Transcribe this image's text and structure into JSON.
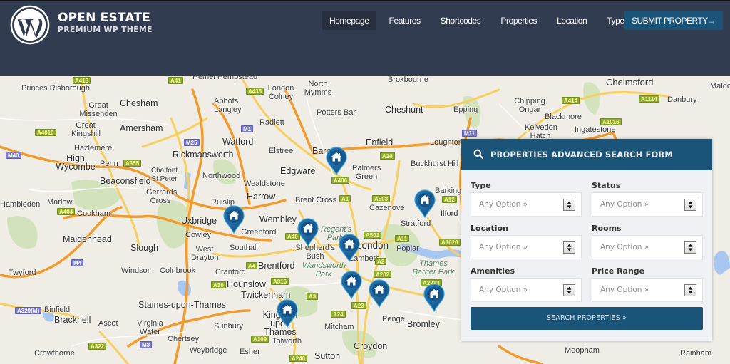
{
  "header": {
    "brand_title": "OPEN ESTATE",
    "brand_subtitle": "PREMIUM WP THEME",
    "logo_icon": "wordpress-logo-icon",
    "nav": [
      {
        "label": "Homepage",
        "active": true
      },
      {
        "label": "Features",
        "active": false
      },
      {
        "label": "Shortcodes",
        "active": false
      },
      {
        "label": "Properties",
        "active": false
      },
      {
        "label": "Location",
        "active": false
      },
      {
        "label": "Type",
        "active": false
      }
    ],
    "submit_label": "SUBMIT PROPERTY→"
  },
  "colors": {
    "header_bg": "#323c51",
    "accent": "#1a5478",
    "panel_bg": "#eef0f3"
  },
  "map": {
    "places": [
      "Princes Risborough",
      "Chesham",
      "Great Missenden",
      "Amersham",
      "Great Kingshill",
      "Hazlemere",
      "Rickmansworth",
      "High Wycombe",
      "Penn",
      "Chalfont St Peter",
      "Beaconsfield",
      "Northwood",
      "Gerrards Cross",
      "Marlow",
      "Cookham",
      "Hambleden",
      "Uxbridge",
      "Ruislip",
      "Maidenhead",
      "Slough",
      "Cowley",
      "West Drayton",
      "Windsor",
      "Colnbrook",
      "Twyford",
      "Cranford",
      "Hounslow",
      "Binfield",
      "Bracknell",
      "Staines-upon-Thames",
      "Ascot",
      "Virginia Water",
      "Chertsey",
      "Sunbury",
      "Weybridge",
      "Crowthorne",
      "Esher",
      "Watford",
      "Radlett",
      "London Colney",
      "North Mymms",
      "Potters Bar",
      "Broxbourne",
      "Cheshunt",
      "Epping",
      "Enfield",
      "Elstree",
      "Barnet",
      "Edgware",
      "Palmers Green",
      "Loughton",
      "Buckhurst Hill",
      "Wealdstone",
      "Harrow",
      "Brent Cross",
      "Wembley",
      "Greenford",
      "Southall",
      "Shepherd's Bush",
      "Regent's Park",
      "London",
      "Lambeth",
      "Brentford",
      "Wandsworth Park",
      "Twickenham",
      "Kingston upon Thames",
      "Mitcham",
      "Tolworth",
      "Croydon",
      "Sutton",
      "Penge",
      "Bromley",
      "Cazenove",
      "Stratford",
      "Ilford",
      "Barkingside",
      "Poplar",
      "Thames Barrier Park",
      "Chelmsford",
      "Chipping Ongar",
      "Blackmore",
      "Kelvedon Hatch",
      "Ingatestone",
      "Danbury",
      "Maldon",
      "Meopham",
      "Rainham",
      "Abbots Langley",
      "Hemel Hempstead"
    ],
    "roads": [
      "A413",
      "A41",
      "A4010",
      "M40",
      "A355",
      "A404",
      "M25",
      "M4",
      "A329(M)",
      "A322",
      "M3",
      "A30",
      "A435",
      "M1",
      "A406",
      "A10",
      "A1",
      "A503",
      "A12",
      "A40",
      "A501",
      "A11",
      "A1020",
      "A316",
      "A4",
      "A3",
      "A202",
      "A2",
      "A24",
      "A23",
      "A2213",
      "A309",
      "A240",
      "A414",
      "A1114",
      "A1016",
      "M11"
    ],
    "property_markers": 9,
    "marker_icon": "house-icon"
  },
  "search_form": {
    "title": "PROPERTIES ADVANCED SEARCH FORM",
    "fields": [
      {
        "label": "Type",
        "value": "Any Option »"
      },
      {
        "label": "Status",
        "value": "Any Option »"
      },
      {
        "label": "Location",
        "value": "Any Option »"
      },
      {
        "label": "Rooms",
        "value": "Any Option »"
      },
      {
        "label": "Amenities",
        "value": "Any Option »"
      },
      {
        "label": "Price Range",
        "value": "Any Option »"
      }
    ],
    "submit_label": "SEARCH PROPERTIES »"
  }
}
